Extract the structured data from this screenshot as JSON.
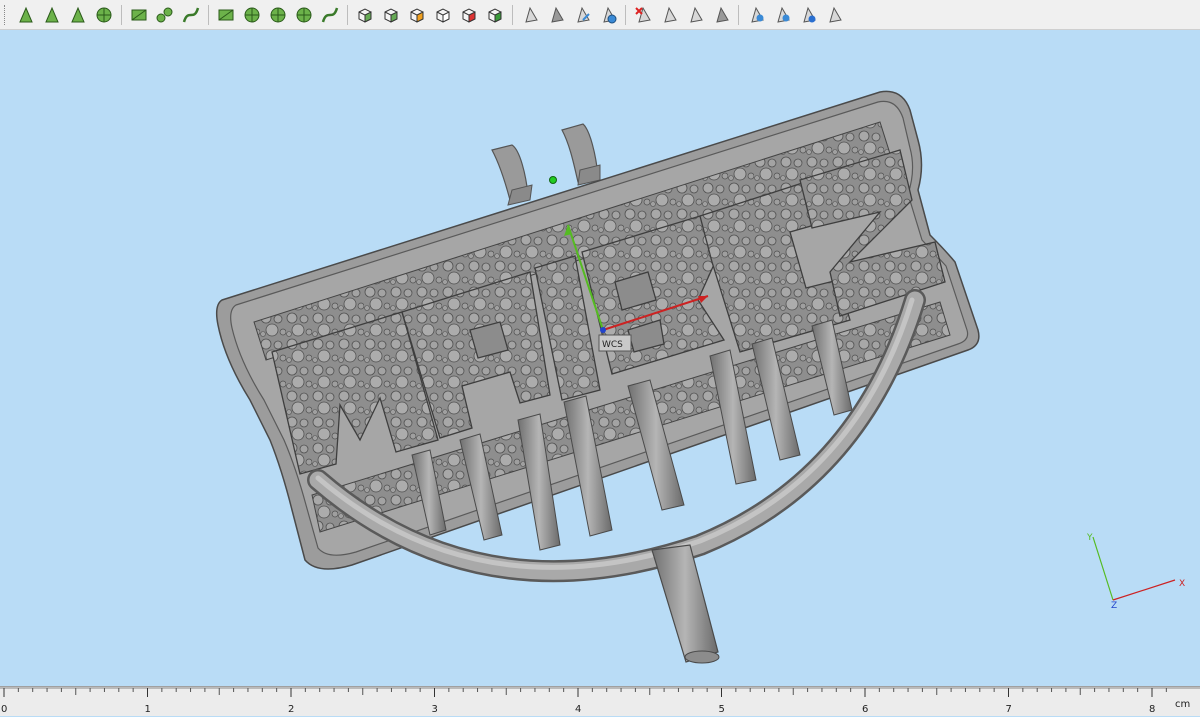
{
  "toolbar": {
    "groups": [
      {
        "icons": [
          "select-point-icon",
          "select-edge-icon",
          "select-path-icon",
          "select-sphere-icon"
        ]
      },
      {
        "icons": [
          "rect-select-icon",
          "connect-select-icon",
          "curve-select-icon"
        ]
      },
      {
        "icons": [
          "mesh-select-icon",
          "cluster-select-icon",
          "component-select-icon",
          "wheel-select-icon",
          "lasso-select-icon"
        ]
      },
      {
        "icons": [
          "cube-view-icon",
          "cube-front-icon",
          "cube-color-icon",
          "cube-wire-icon",
          "cube-red-icon",
          "cube-green-icon"
        ]
      },
      {
        "icons": [
          "triangle-icon",
          "triangle-fill-icon",
          "triangle-arrow-icon",
          "triangle-globe-icon"
        ]
      },
      {
        "icons": [
          "triangle-delete-icon",
          "triangle-shade-icon",
          "triangle-outline-icon",
          "triangle-solid-icon"
        ]
      },
      {
        "icons": [
          "triangle-light-icon",
          "triangle-search-icon",
          "triangle-info-icon",
          "triangle-grid-icon"
        ]
      }
    ]
  },
  "viewport": {
    "wcs_label": "WCS",
    "triad": {
      "x": "X",
      "y": "Y",
      "z": "Z"
    },
    "colors": {
      "background": "#b9dcf6",
      "model": "#9a9a9a",
      "x_axis": "#cc2222",
      "y_axis": "#55bb22"
    }
  },
  "ruler": {
    "unit": "cm",
    "ticks": [
      "0",
      "1",
      "2",
      "3",
      "4",
      "5",
      "6",
      "7",
      "8"
    ]
  }
}
